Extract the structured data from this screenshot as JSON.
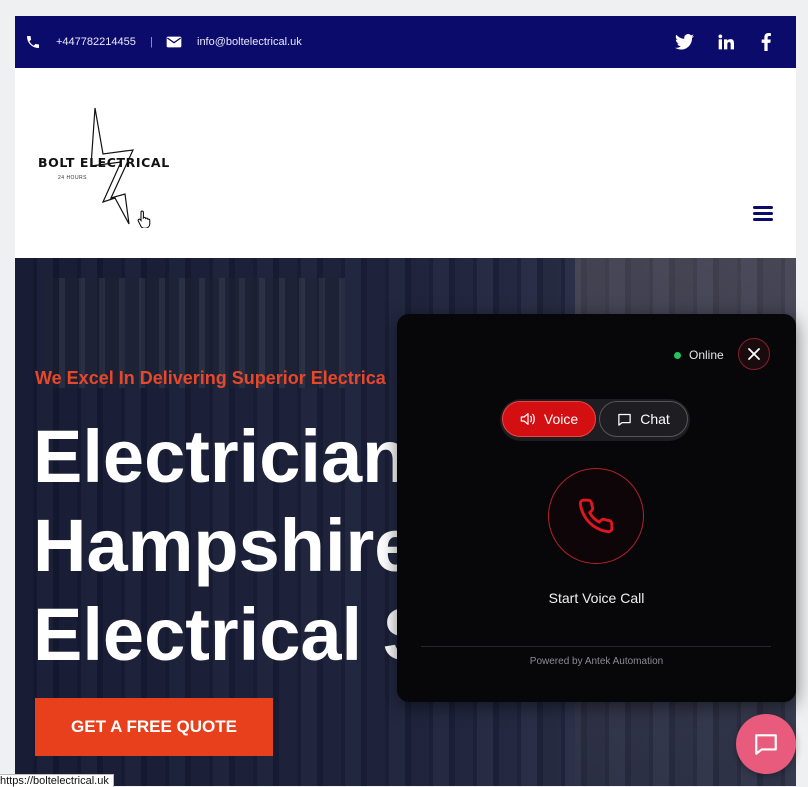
{
  "topbar": {
    "phone_icon": "phone-icon",
    "phone": "+447782214455",
    "separator": "|",
    "mail_icon": "envelope-icon",
    "email": "info@boltelectrical.uk",
    "social": [
      "twitter-icon",
      "linkedin-icon",
      "facebook-icon"
    ]
  },
  "header": {
    "logo_text": "BOLT ELECTRICAL",
    "logo_sub": "24 HOURS",
    "menu_icon": "hamburger-menu-icon"
  },
  "hero": {
    "tagline": "We Excel In Delivering Superior Electrica",
    "headline": [
      "Electrician",
      "Hampshire",
      "Electrical S"
    ],
    "cta_label": "GET A FREE QUOTE"
  },
  "widget": {
    "status": "Online",
    "tabs": {
      "voice": "Voice",
      "chat": "Chat"
    },
    "call_label": "Start Voice Call",
    "powered_by": "Powered by Antek Automation"
  },
  "status_url": "https://boltelectrical.uk",
  "colors": {
    "topbar_bg": "#0b0b6b",
    "accent_orange": "#e8401c",
    "widget_red": "#d40f12",
    "online_green": "#22c55e",
    "fab_pink": "#e85b7d"
  }
}
